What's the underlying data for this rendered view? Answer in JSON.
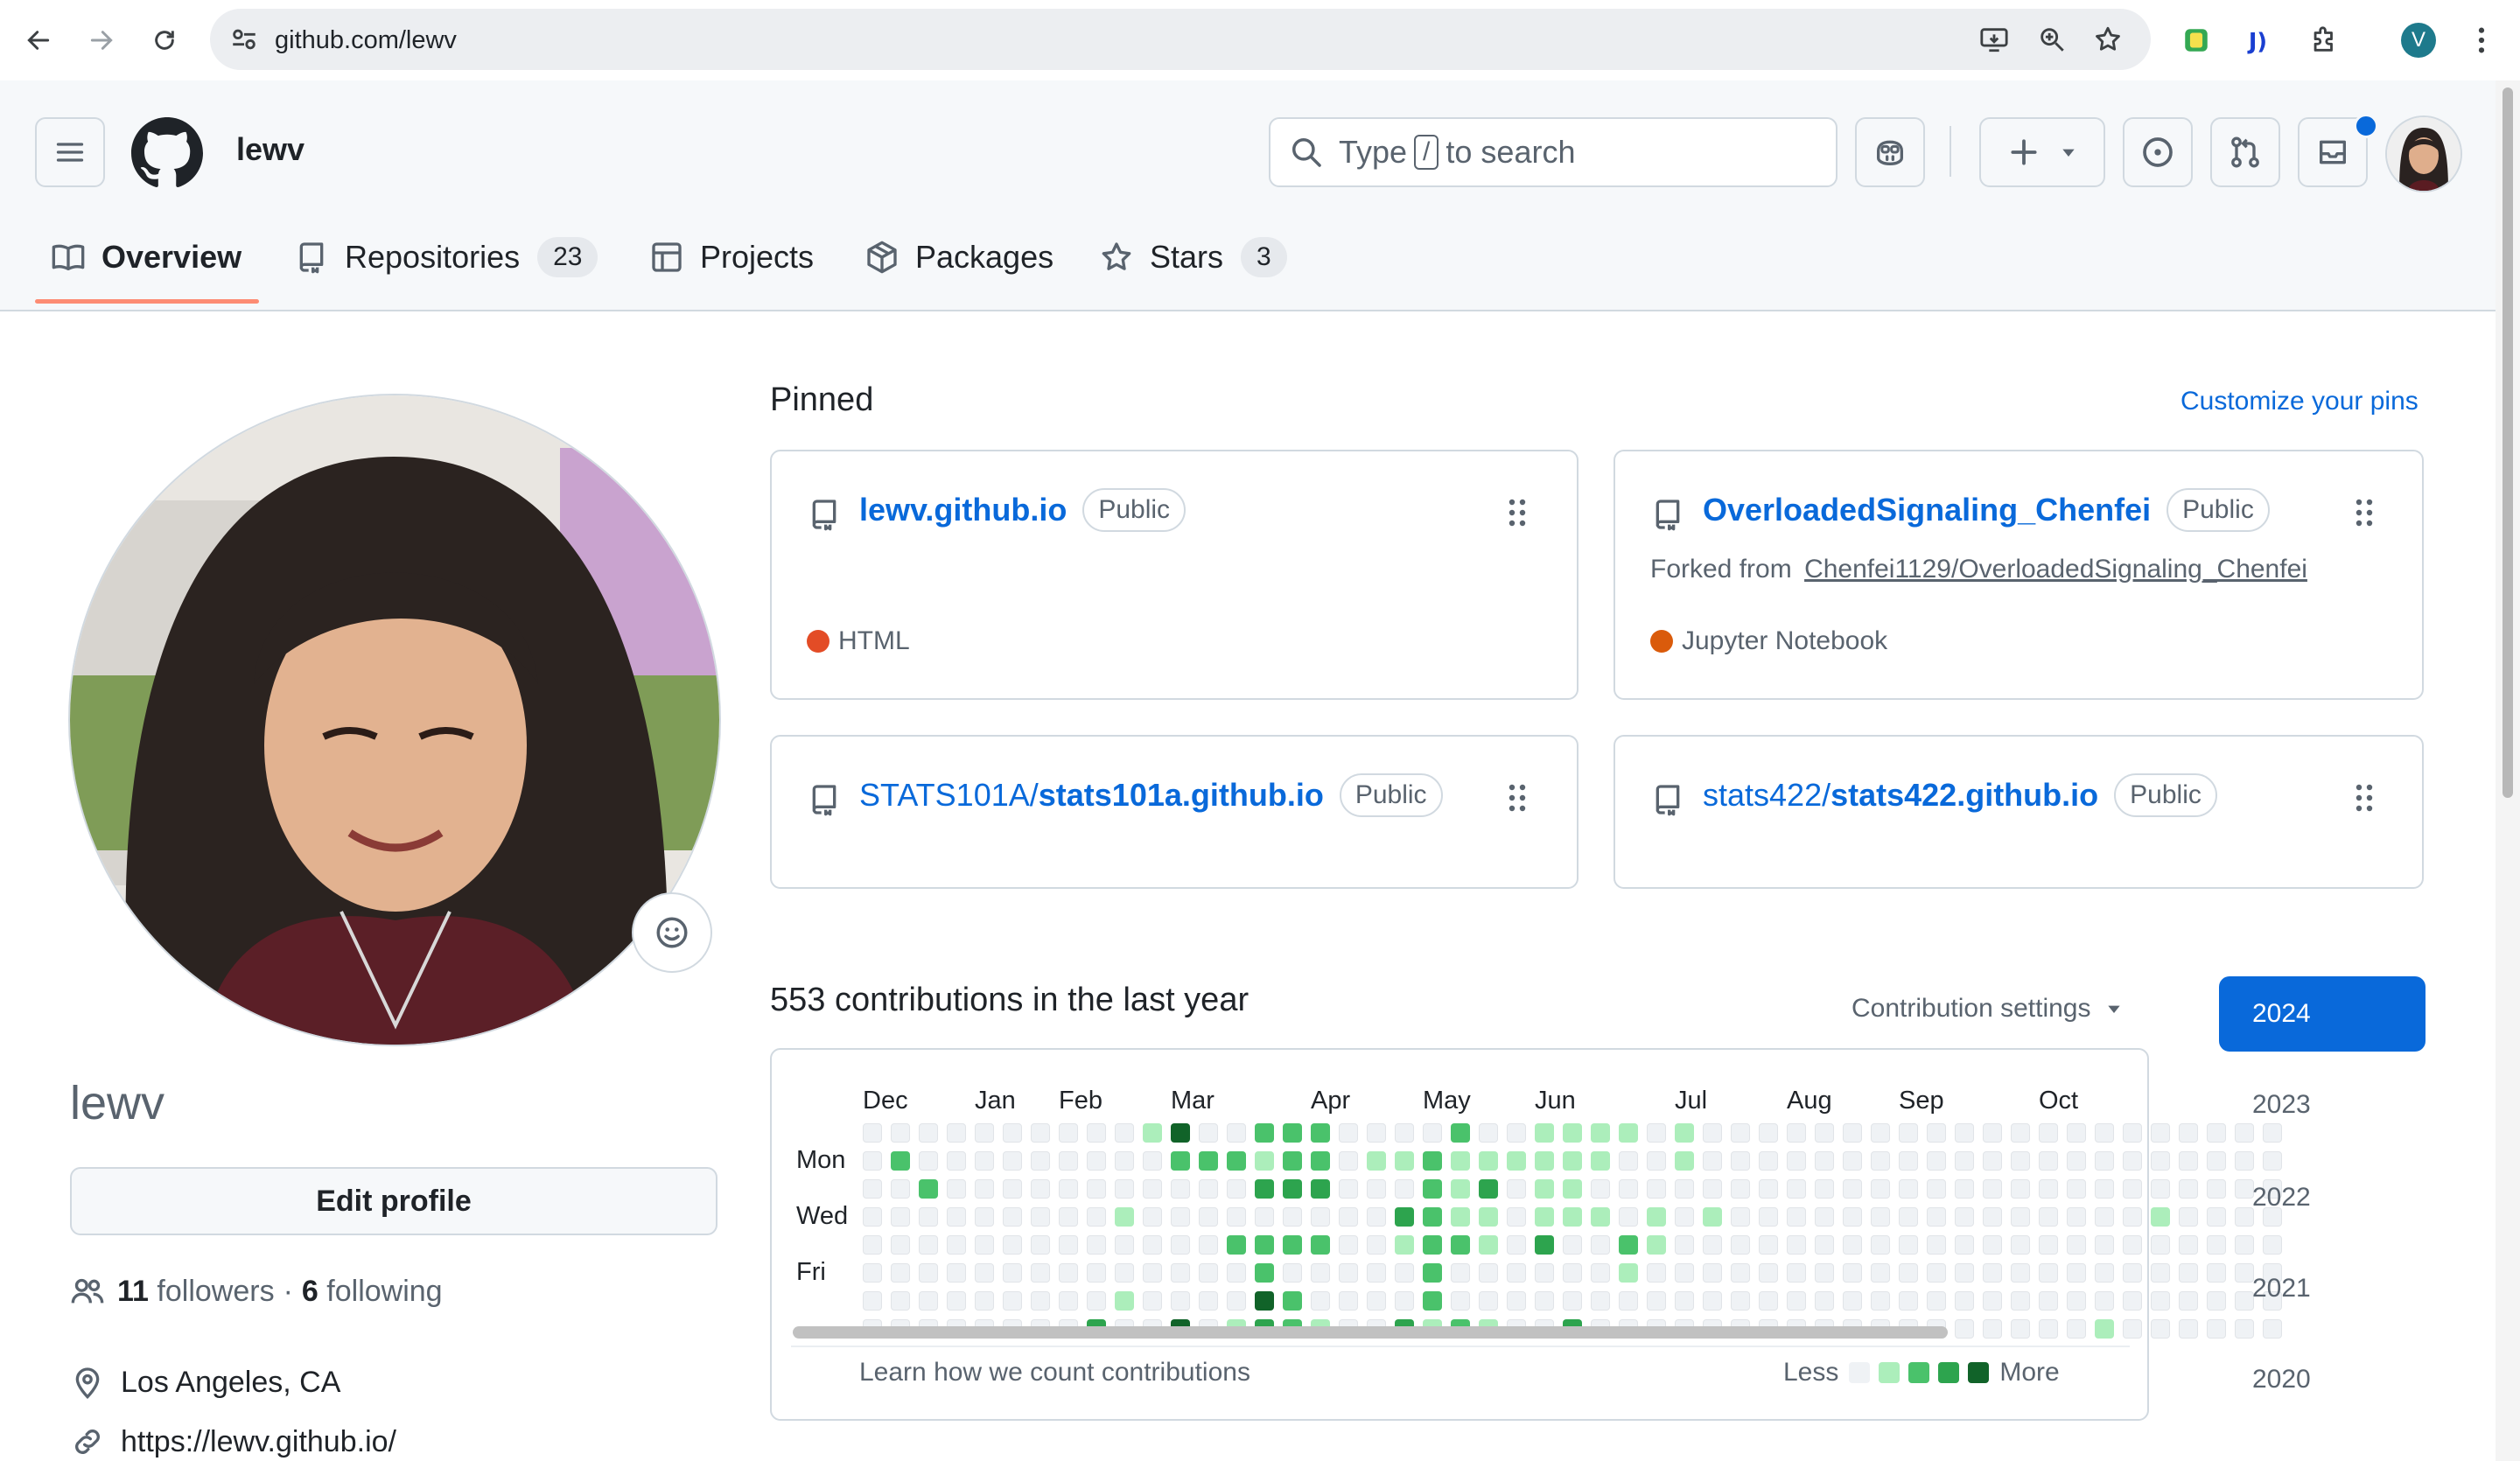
{
  "browser": {
    "url": "github.com/lewv",
    "profile_initial": "V"
  },
  "header": {
    "username": "lewv",
    "search_prefix": "Type",
    "search_key": "/",
    "search_suffix": "to search"
  },
  "tabs": [
    {
      "label": "Overview",
      "icon": "book-icon",
      "selected": true
    },
    {
      "label": "Repositories",
      "count": "23",
      "icon": "repo-icon"
    },
    {
      "label": "Projects",
      "icon": "table-icon"
    },
    {
      "label": "Packages",
      "icon": "package-icon"
    },
    {
      "label": "Stars",
      "count": "3",
      "icon": "star-icon"
    }
  ],
  "profile": {
    "name": "lewv",
    "edit_label": "Edit profile",
    "followers_count": "11",
    "followers_label": "followers",
    "separator": "·",
    "following_count": "6",
    "following_label": "following",
    "location": "Los Angeles, CA",
    "website": "https://lewv.github.io/"
  },
  "pinned": {
    "title": "Pinned",
    "customize": "Customize your pins",
    "repos": [
      {
        "owner": "",
        "name": "lewv.github.io",
        "visibility": "Public",
        "forked_label": "",
        "forked_from": "",
        "language": "HTML",
        "language_color": "#e34c26"
      },
      {
        "owner": "",
        "name": "OverloadedSignaling_Chenfei",
        "visibility": "Public",
        "forked_label": "Forked from",
        "forked_from": "Chenfei1129/OverloadedSignaling_Chenfei",
        "language": "Jupyter Notebook",
        "language_color": "#DA5B0B"
      },
      {
        "owner": "STATS101A/",
        "name": "stats101a.github.io",
        "visibility": "Public",
        "forked_label": "",
        "forked_from": "",
        "language": "",
        "language_color": ""
      },
      {
        "owner": "stats422/",
        "name": "stats422.github.io",
        "visibility": "Public",
        "forked_label": "",
        "forked_from": "",
        "language": "",
        "language_color": ""
      }
    ]
  },
  "contributions": {
    "title": "553 contributions in the last year",
    "settings_label": "Contribution settings",
    "months": [
      "Dec",
      "Jan",
      "Feb",
      "Mar",
      "Apr",
      "May",
      "Jun",
      "Jul",
      "Aug",
      "Sep",
      "Oct"
    ],
    "day_labels": [
      "Mon",
      "Wed",
      "Fri"
    ],
    "learn_link": "Learn how we count contributions",
    "legend_less": "Less",
    "legend_more": "More",
    "level_colors": [
      "#eff2f5",
      "#aceebb",
      "#4ac26b",
      "#2da44e",
      "#116329"
    ],
    "years": [
      "2024",
      "2023",
      "2022",
      "2021",
      "2020"
    ],
    "selected_year": "2024",
    "levels": [
      [
        0,
        0,
        0,
        0,
        0,
        0,
        0,
        0
      ],
      [
        0,
        2,
        0,
        0,
        0,
        0,
        0,
        0
      ],
      [
        0,
        0,
        2,
        0,
        0,
        0,
        0,
        0
      ],
      [
        0,
        0,
        0,
        0,
        0,
        0,
        0,
        0
      ],
      [
        0,
        0,
        0,
        0,
        0,
        0,
        0,
        0
      ],
      [
        0,
        0,
        0,
        0,
        0,
        0,
        0,
        0
      ],
      [
        0,
        0,
        0,
        0,
        0,
        0,
        0,
        0
      ],
      [
        0,
        0,
        0,
        0,
        0,
        0,
        0,
        0
      ],
      [
        0,
        0,
        0,
        0,
        0,
        0,
        0,
        3
      ],
      [
        0,
        0,
        0,
        1,
        0,
        0,
        1,
        0
      ],
      [
        1,
        0,
        0,
        0,
        0,
        0,
        0,
        0
      ],
      [
        4,
        2,
        0,
        0,
        0,
        0,
        0,
        4
      ],
      [
        0,
        2,
        0,
        0,
        0,
        0,
        0,
        0
      ],
      [
        0,
        2,
        0,
        0,
        2,
        0,
        0,
        1
      ],
      [
        2,
        1,
        3,
        0,
        2,
        2,
        4,
        3
      ],
      [
        2,
        2,
        3,
        0,
        2,
        0,
        2,
        2
      ],
      [
        2,
        2,
        3,
        0,
        2,
        0,
        0,
        1
      ],
      [
        0,
        0,
        0,
        0,
        0,
        0,
        0,
        0
      ],
      [
        0,
        1,
        0,
        0,
        0,
        0,
        0,
        0
      ],
      [
        0,
        1,
        0,
        3,
        1,
        0,
        0,
        3
      ],
      [
        0,
        2,
        2,
        2,
        2,
        2,
        2,
        1
      ],
      [
        2,
        1,
        1,
        1,
        2,
        0,
        0,
        2
      ],
      [
        0,
        1,
        3,
        1,
        1,
        0,
        0,
        1
      ],
      [
        0,
        1,
        0,
        0,
        0,
        0,
        0,
        0
      ],
      [
        1,
        1,
        1,
        1,
        3,
        0,
        0,
        0
      ],
      [
        1,
        1,
        1,
        1,
        0,
        0,
        0,
        3
      ],
      [
        1,
        1,
        0,
        1,
        0,
        0,
        0,
        0
      ],
      [
        1,
        0,
        0,
        0,
        2,
        1,
        0,
        0
      ],
      [
        0,
        0,
        0,
        1,
        1,
        0,
        0,
        0
      ],
      [
        1,
        1,
        0,
        0,
        0,
        0,
        0,
        0
      ],
      [
        0,
        0,
        0,
        1,
        0,
        0,
        0,
        0
      ],
      [
        0,
        0,
        0,
        0,
        0,
        0,
        0,
        0
      ],
      [
        0,
        0,
        0,
        0,
        0,
        0,
        0,
        0
      ],
      [
        0,
        0,
        0,
        0,
        0,
        0,
        0,
        0
      ],
      [
        0,
        0,
        0,
        0,
        0,
        0,
        0,
        0
      ],
      [
        0,
        0,
        0,
        0,
        0,
        0,
        0,
        0
      ],
      [
        0,
        0,
        0,
        0,
        0,
        0,
        0,
        0
      ],
      [
        0,
        0,
        0,
        0,
        0,
        0,
        0,
        0
      ],
      [
        0,
        0,
        0,
        0,
        0,
        0,
        0,
        0
      ],
      [
        0,
        0,
        0,
        0,
        0,
        0,
        0,
        0
      ],
      [
        0,
        0,
        0,
        0,
        0,
        0,
        0,
        0
      ],
      [
        0,
        0,
        0,
        0,
        0,
        0,
        0,
        0
      ],
      [
        0,
        0,
        0,
        0,
        0,
        0,
        0,
        0
      ],
      [
        0,
        0,
        0,
        0,
        0,
        0,
        0,
        0
      ],
      [
        0,
        0,
        0,
        0,
        0,
        0,
        0,
        1
      ],
      [
        0,
        0,
        0,
        0,
        0,
        0,
        0,
        0
      ],
      [
        0,
        0,
        0,
        1,
        0,
        0,
        0,
        0
      ],
      [
        0,
        0,
        0,
        0,
        0,
        0,
        0,
        0
      ],
      [
        0,
        0,
        0,
        0,
        0,
        0,
        0,
        0
      ],
      [
        0,
        0,
        0,
        0,
        0,
        0,
        0,
        0
      ],
      [
        0,
        0,
        0,
        0,
        0,
        0,
        0,
        0
      ]
    ]
  }
}
